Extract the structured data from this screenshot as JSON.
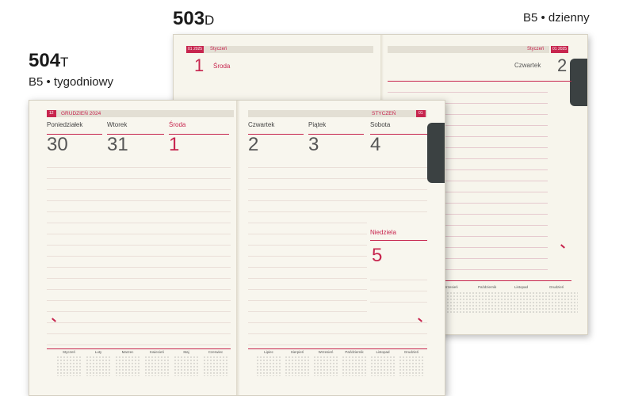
{
  "labels": {
    "daily_code": "503",
    "daily_suffix": "D",
    "daily_desc": "B5 • dzienny",
    "weekly_code": "504",
    "weekly_suffix": "T",
    "weekly_desc": "B5 • tygodniowy"
  },
  "daily": {
    "left": {
      "month_tag": "01 2025",
      "month_name": "Styczeń",
      "day_number": "1",
      "day_name": "Środa"
    },
    "right": {
      "month_tag": "01 2025",
      "month_name": "Styczeń",
      "day_number": "2",
      "day_name": "Czwartek"
    }
  },
  "weekly": {
    "left": {
      "month_tag": "12",
      "month_name": "GRUDZIEŃ 2024",
      "days": [
        {
          "name": "Poniedziałek",
          "number": "30",
          "highlight": false
        },
        {
          "name": "Wtorek",
          "number": "31",
          "highlight": false
        },
        {
          "name": "Środa",
          "number": "1",
          "highlight": true
        }
      ]
    },
    "right": {
      "month_tag": "01",
      "month_name": "STYCZEŃ",
      "days": [
        {
          "name": "Czwartek",
          "number": "2",
          "highlight": false
        },
        {
          "name": "Piątek",
          "number": "3",
          "highlight": false
        },
        {
          "name": "Sobota",
          "number": "4",
          "highlight": false
        }
      ],
      "sunday": {
        "name": "Niedziela",
        "number": "5"
      }
    },
    "calendar_left": [
      "Styczeń",
      "Luty",
      "Marzec",
      "Kwiecień",
      "Maj",
      "Czerwiec"
    ],
    "calendar_right": [
      "Lipiec",
      "Sierpień",
      "Wrzesień",
      "Październik",
      "Listopad",
      "Grudzień"
    ]
  },
  "daily_calendar_months": [
    "Wrzesień",
    "Październik",
    "Listopad",
    "Grudzień"
  ],
  "accent_color": "#c7254e",
  "paper_color": "#f8f6ee",
  "tab_color": "#3b4142"
}
